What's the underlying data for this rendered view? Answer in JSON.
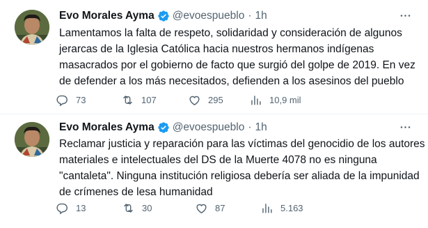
{
  "colors": {
    "text": "#0f1419",
    "secondary": "#536471",
    "verified": "#1d9bf0",
    "divider": "#eff3f4"
  },
  "tweets": [
    {
      "name": "Evo Morales Ayma",
      "handle": "@evoespueblo",
      "dot": "·",
      "time": "1h",
      "lines": [
        "Lamentamos la falta de respeto, solidaridad y consideración de algunos",
        "jerarcas de la Iglesia Católica hacia nuestros hermanos indígenas",
        "masacrados por el gobierno de facto que surgió del golpe de 2019. En vez",
        "de defender a los más necesitados, defienden a los asesinos del pueblo"
      ],
      "replies": "73",
      "retweets": "107",
      "likes": "295",
      "views": "10,9 mil",
      "icons": [
        "reply-icon",
        "retweet-icon",
        "like-icon",
        "views-icon",
        "more-icon",
        "verified-icon"
      ]
    },
    {
      "name": "Evo Morales Ayma",
      "handle": "@evoespueblo",
      "dot": "·",
      "time": "1h",
      "lines": [
        "Reclamar justicia y reparación para las víctimas del genocidio de los autores",
        "materiales e intelectuales del DS de la Muerte 4078 no es ninguna",
        "\"cantaleta\". Ninguna institución religiosa debería ser aliada de la impunidad",
        "de crímenes de lesa humanidad"
      ],
      "replies": "13",
      "retweets": "30",
      "likes": "87",
      "views": "5.163",
      "icons": [
        "reply-icon",
        "retweet-icon",
        "like-icon",
        "views-icon",
        "more-icon",
        "verified-icon"
      ]
    }
  ]
}
